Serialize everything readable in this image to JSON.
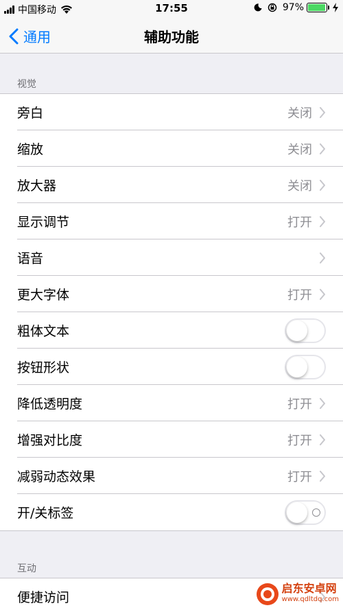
{
  "status_bar": {
    "carrier": "中国移动",
    "time": "17:55",
    "battery": "97%",
    "battery_level": 0.97
  },
  "nav": {
    "back_label": "通用",
    "title": "辅助功能"
  },
  "sections": [
    {
      "header": "视觉",
      "rows": [
        {
          "label": "旁白",
          "value": "关闭",
          "type": "disclosure"
        },
        {
          "label": "缩放",
          "value": "关闭",
          "type": "disclosure"
        },
        {
          "label": "放大器",
          "value": "关闭",
          "type": "disclosure"
        },
        {
          "label": "显示调节",
          "value": "打开",
          "type": "disclosure"
        },
        {
          "label": "语音",
          "value": "",
          "type": "disclosure"
        },
        {
          "label": "更大字体",
          "value": "打开",
          "type": "disclosure"
        },
        {
          "label": "粗体文本",
          "type": "toggle",
          "on": false
        },
        {
          "label": "按钮形状",
          "type": "toggle",
          "on": false
        },
        {
          "label": "降低透明度",
          "value": "打开",
          "type": "disclosure"
        },
        {
          "label": "增强对比度",
          "value": "打开",
          "type": "disclosure"
        },
        {
          "label": "减弱动态效果",
          "value": "打开",
          "type": "disclosure"
        },
        {
          "label": "开/关标签",
          "type": "toggle",
          "on": false,
          "labels": true
        }
      ]
    },
    {
      "header": "互动",
      "rows": [
        {
          "label": "便捷访问",
          "type": "disclosure"
        }
      ]
    }
  ],
  "watermark": {
    "name": "启东安卓网",
    "url": "www.qdltdq.com"
  },
  "colors": {
    "accent": "#007aff",
    "background": "#efeff4",
    "battery": "#4cd964"
  }
}
